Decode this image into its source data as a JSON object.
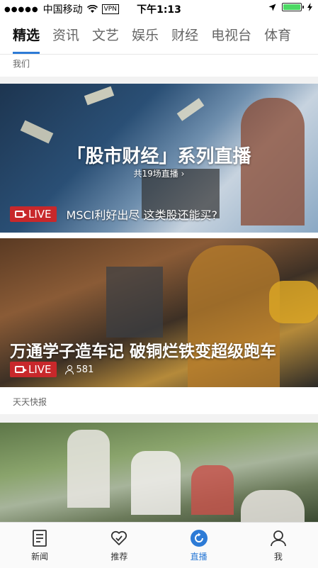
{
  "status_bar": {
    "carrier": "中国移动",
    "vpn": "VPN",
    "time": "下午1:13",
    "battery_level": 1.0
  },
  "tabs": [
    {
      "label": "精选",
      "active": true
    },
    {
      "label": "资讯",
      "active": false
    },
    {
      "label": "文艺",
      "active": false
    },
    {
      "label": "娱乐",
      "active": false
    },
    {
      "label": "财经",
      "active": false
    },
    {
      "label": "电视台",
      "active": false
    },
    {
      "label": "体育",
      "active": false
    }
  ],
  "sections": {
    "top_label": "我们",
    "quick_label": "天天快报"
  },
  "card1": {
    "title": "「股市财经」系列直播",
    "subtitle": "共19场直播",
    "live_label": "LIVE",
    "headline": "MSCI利好出尽 这类股还能买?"
  },
  "card2": {
    "headline": "万通学子造车记 破铜烂铁变超级跑车",
    "live_label": "LIVE",
    "viewers": "581"
  },
  "bottom_nav": [
    {
      "label": "新闻",
      "icon": "news-icon",
      "active": false
    },
    {
      "label": "推荐",
      "icon": "heart-icon",
      "active": false
    },
    {
      "label": "直播",
      "icon": "live-icon",
      "active": true
    },
    {
      "label": "我",
      "icon": "profile-icon",
      "active": false
    }
  ],
  "colors": {
    "accent": "#2d7bd6",
    "live_red": "#c8282b"
  }
}
